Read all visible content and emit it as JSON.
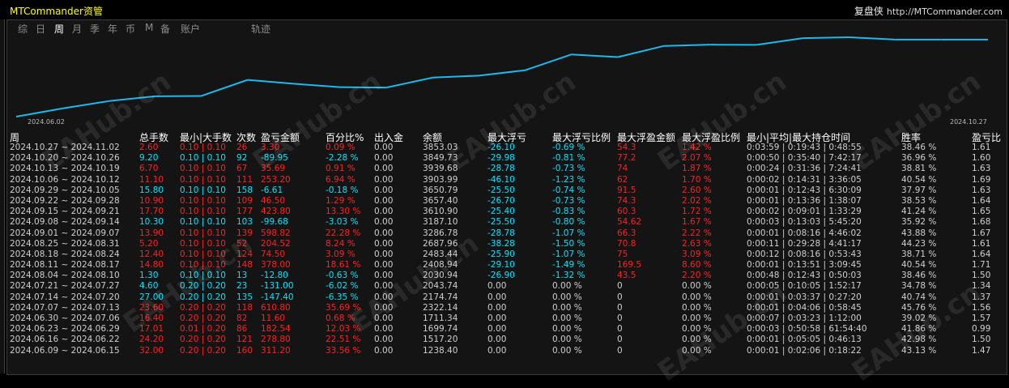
{
  "window": {
    "title": "MTCommander资管",
    "brand_cn": "复盘侠",
    "brand_url": "http://MTCommander.com"
  },
  "tabs": [
    "综",
    "日",
    "周",
    "月",
    "季",
    "年",
    "币",
    "M",
    "备",
    "账户",
    "轨迹"
  ],
  "active_tab": "周",
  "chart_data": {
    "type": "line",
    "x_start_label": "2024.06.02",
    "x_end_label": "2024.10.27",
    "x": [
      "2024.06.02",
      "2024.06.09",
      "2024.06.16",
      "2024.06.23",
      "2024.06.30",
      "2024.07.07",
      "2024.07.14",
      "2024.07.21",
      "2024.07.28",
      "2024.08.04",
      "2024.08.11",
      "2024.08.18",
      "2024.08.25",
      "2024.09.01",
      "2024.09.08",
      "2024.09.15",
      "2024.09.22",
      "2024.09.29",
      "2024.10.06",
      "2024.10.13",
      "2024.10.20",
      "2024.10.27"
    ],
    "values": [
      927.2,
      1238.4,
      1517.2,
      1699.74,
      1711.34,
      2322.14,
      2174.74,
      2043.74,
      2030.94,
      2408.94,
      2483.44,
      2687.96,
      3286.78,
      3187.1,
      3610.9,
      3657.4,
      3650.79,
      3903.99,
      3939.68,
      3849.73,
      3853.03,
      3853.03
    ],
    "line_color": "#1fb8ea"
  },
  "table": {
    "headers": {
      "period": "周",
      "lots": "总手数",
      "minmax": "最小|大手数",
      "count": "次数",
      "pl": "盈亏金额",
      "pct": "百分比%",
      "dw": "出入金",
      "balance": "余额",
      "max_float_loss": "最大浮亏",
      "max_float_loss_pct": "最大浮亏比例",
      "max_float_gain": "最大浮盈金额",
      "max_float_gain_pct": "最大浮盈比例",
      "hold": "最小|平均|最大持仓时间",
      "winrate": "胜率",
      "ratio": "盈亏比"
    },
    "rows": [
      {
        "period": "2024.10.27 ~ 2024.11.02",
        "lots": "2.60",
        "minmax": "0.10 | 0.10",
        "count": "26",
        "pl": "3.30",
        "pct": "0.09 %",
        "dw": "0.00",
        "balance": "3853.03",
        "mfl": "-26.10",
        "mflp": "-0.69 %",
        "mfg": "54.3",
        "mfgp": "1.42 %",
        "hold": "0:03:59 | 0:19:43 | 0:48:55",
        "win": "38.46 %",
        "ratio": "1.61",
        "sign": "pos"
      },
      {
        "period": "2024.10.20 ~ 2024.10.26",
        "lots": "9.20",
        "minmax": "0.10 | 0.10",
        "count": "92",
        "pl": "-89.95",
        "pct": "-2.28 %",
        "dw": "0.00",
        "balance": "3849.73",
        "mfl": "-29.98",
        "mflp": "-0.81 %",
        "mfg": "77.2",
        "mfgp": "2.07 %",
        "hold": "0:00:50 | 0:35:40 | 7:42:17",
        "win": "36.96 %",
        "ratio": "1.60",
        "sign": "neg"
      },
      {
        "period": "2024.10.13 ~ 2024.10.19",
        "lots": "6.70",
        "minmax": "0.10 | 0.10",
        "count": "67",
        "pl": "35.69",
        "pct": "0.91 %",
        "dw": "0.00",
        "balance": "3939.68",
        "mfl": "-28.78",
        "mflp": "-0.73 %",
        "mfg": "74",
        "mfgp": "1.87 %",
        "hold": "0:00:24 | 0:31:36 | 7:24:41",
        "win": "38.81 %",
        "ratio": "1.63",
        "sign": "pos"
      },
      {
        "period": "2024.10.06 ~ 2024.10.12",
        "lots": "11.10",
        "minmax": "0.10 | 0.10",
        "count": "111",
        "pl": "253.20",
        "pct": "6.94 %",
        "dw": "0.00",
        "balance": "3903.99",
        "mfl": "-46.10",
        "mflp": "-1.23 %",
        "mfg": "62",
        "mfgp": "1.70 %",
        "hold": "0:00:02 | 0:14:31 | 3:36:05",
        "win": "40.54 %",
        "ratio": "1.69",
        "sign": "pos"
      },
      {
        "period": "2024.09.29 ~ 2024.10.05",
        "lots": "15.80",
        "minmax": "0.10 | 0.10",
        "count": "158",
        "pl": "-6.61",
        "pct": "-0.18 %",
        "dw": "0.00",
        "balance": "3650.79",
        "mfl": "-25.50",
        "mflp": "-0.74 %",
        "mfg": "91.5",
        "mfgp": "2.60 %",
        "hold": "0:00:01 | 0:12:43 | 6:30:09",
        "win": "37.97 %",
        "ratio": "1.63",
        "sign": "neg"
      },
      {
        "period": "2024.09.22 ~ 2024.09.28",
        "lots": "10.90",
        "minmax": "0.10 | 0.10",
        "count": "109",
        "pl": "46.50",
        "pct": "1.29 %",
        "dw": "0.00",
        "balance": "3657.40",
        "mfl": "-26.70",
        "mflp": "-0.73 %",
        "mfg": "74.3",
        "mfgp": "2.02 %",
        "hold": "0:00:01 | 0:13:36 | 1:38:07",
        "win": "38.53 %",
        "ratio": "1.64",
        "sign": "pos"
      },
      {
        "period": "2024.09.15 ~ 2024.09.21",
        "lots": "17.70",
        "minmax": "0.10 | 0.10",
        "count": "177",
        "pl": "423.80",
        "pct": "13.30 %",
        "dw": "0.00",
        "balance": "3610.90",
        "mfl": "-25.40",
        "mflp": "-0.83 %",
        "mfg": "60.3",
        "mfgp": "1.72 %",
        "hold": "0:00:02 | 0:09:01 | 1:33:29",
        "win": "41.24 %",
        "ratio": "1.65",
        "sign": "pos"
      },
      {
        "period": "2024.09.08 ~ 2024.09.14",
        "lots": "10.30",
        "minmax": "0.10 | 0.10",
        "count": "103",
        "pl": "-99.68",
        "pct": "-3.03 %",
        "dw": "0.00",
        "balance": "3187.10",
        "mfl": "-25.50",
        "mflp": "-0.80 %",
        "mfg": "54.62",
        "mfgp": "1.67 %",
        "hold": "0:00:03 | 0:13:03 | 5:45:20",
        "win": "35.92 %",
        "ratio": "1.68",
        "sign": "neg"
      },
      {
        "period": "2024.09.01 ~ 2024.09.07",
        "lots": "13.90",
        "minmax": "0.10 | 0.10",
        "count": "139",
        "pl": "598.82",
        "pct": "22.28 %",
        "dw": "0.00",
        "balance": "3286.78",
        "mfl": "-28.78",
        "mflp": "-1.07 %",
        "mfg": "66.3",
        "mfgp": "2.22 %",
        "hold": "0:00:01 | 0:08:16 | 4:46:02",
        "win": "43.88 %",
        "ratio": "1.67",
        "sign": "pos"
      },
      {
        "period": "2024.08.25 ~ 2024.08.31",
        "lots": "5.20",
        "minmax": "0.10 | 0.10",
        "count": "52",
        "pl": "204.52",
        "pct": "8.24 %",
        "dw": "0.00",
        "balance": "2687.96",
        "mfl": "-38.28",
        "mflp": "-1.50 %",
        "mfg": "70.8",
        "mfgp": "2.63 %",
        "hold": "0:00:11 | 0:29:28 | 4:41:17",
        "win": "44.23 %",
        "ratio": "1.61",
        "sign": "pos"
      },
      {
        "period": "2024.08.18 ~ 2024.08.24",
        "lots": "12.40",
        "minmax": "0.10 | 0.10",
        "count": "124",
        "pl": "74.50",
        "pct": "3.09 %",
        "dw": "0.00",
        "balance": "2483.44",
        "mfl": "-25.90",
        "mflp": "-1.07 %",
        "mfg": "75",
        "mfgp": "3.09 %",
        "hold": "0:00:12 | 0:08:16 | 0:53:43",
        "win": "38.71 %",
        "ratio": "1.64",
        "sign": "pos"
      },
      {
        "period": "2024.08.11 ~ 2024.08.17",
        "lots": "14.80",
        "minmax": "0.10 | 0.10",
        "count": "148",
        "pl": "378.00",
        "pct": "18.61 %",
        "dw": "0.00",
        "balance": "2408.94",
        "mfl": "-29.10",
        "mflp": "-1.49 %",
        "mfg": "169.5",
        "mfgp": "8.60 %",
        "hold": "0:00:01 | 0:13:51 | 3:09:45",
        "win": "40.54 %",
        "ratio": "1.71",
        "sign": "pos"
      },
      {
        "period": "2024.08.04 ~ 2024.08.10",
        "lots": "1.30",
        "minmax": "0.10 | 0.10",
        "count": "13",
        "pl": "-12.80",
        "pct": "-0.63 %",
        "dw": "0.00",
        "balance": "2030.94",
        "mfl": "-26.90",
        "mflp": "-1.32 %",
        "mfg": "43.5",
        "mfgp": "2.20 %",
        "hold": "0:00:48 | 0:12:43 | 0:50:03",
        "win": "38.46 %",
        "ratio": "1.50",
        "sign": "neg"
      },
      {
        "period": "2024.07.21 ~ 2024.07.27",
        "lots": "4.60",
        "minmax": "0.20 | 0.20",
        "count": "23",
        "pl": "-131.00",
        "pct": "-6.02 %",
        "dw": "0.00",
        "balance": "2043.74",
        "mfl": "0.00",
        "mflp": "0.00 %",
        "mfg": "0",
        "mfgp": "0.00 %",
        "hold": "0:00:05 | 0:10:05 | 1:52:17",
        "win": "34.78 %",
        "ratio": "1.34",
        "sign": "neg"
      },
      {
        "period": "2024.07.14 ~ 2024.07.20",
        "lots": "27.00",
        "minmax": "0.20 | 0.20",
        "count": "135",
        "pl": "-147.40",
        "pct": "-6.35 %",
        "dw": "0.00",
        "balance": "2174.74",
        "mfl": "0.00",
        "mflp": "0.00 %",
        "mfg": "0",
        "mfgp": "0.00 %",
        "hold": "0:00:01 | 0:03:37 | 0:27:20",
        "win": "40.74 %",
        "ratio": "1.37",
        "sign": "neg"
      },
      {
        "period": "2024.07.07 ~ 2024.07.13",
        "lots": "23.60",
        "minmax": "0.20 | 0.20",
        "count": "118",
        "pl": "610.80",
        "pct": "35.69 %",
        "dw": "0.00",
        "balance": "2322.14",
        "mfl": "0.00",
        "mflp": "0.00 %",
        "mfg": "0",
        "mfgp": "0.00 %",
        "hold": "0:00:01 | 0:04:06 | 0:58:45",
        "win": "45.76 %",
        "ratio": "1.56",
        "sign": "pos"
      },
      {
        "period": "2024.06.30 ~ 2024.07.06",
        "lots": "16.40",
        "minmax": "0.20 | 0.20",
        "count": "82",
        "pl": "11.60",
        "pct": "0.68 %",
        "dw": "0.00",
        "balance": "1711.34",
        "mfl": "0.00",
        "mflp": "0.00 %",
        "mfg": "0",
        "mfgp": "0.00 %",
        "hold": "0:00:07 | 0:03:23 | 1:12:00",
        "win": "39.02 %",
        "ratio": "1.57",
        "sign": "pos"
      },
      {
        "period": "2024.06.23 ~ 2024.06.29",
        "lots": "17.01",
        "minmax": "0.01 | 0.20",
        "count": "86",
        "pl": "182.54",
        "pct": "12.03 %",
        "dw": "0.00",
        "balance": "1699.74",
        "mfl": "0.00",
        "mflp": "0.00 %",
        "mfg": "0",
        "mfgp": "0.00 %",
        "hold": "0:00:03 | 0:50:58 | 61:54:40",
        "win": "41.86 %",
        "ratio": "0.99",
        "sign": "pos"
      },
      {
        "period": "2024.06.16 ~ 2024.06.22",
        "lots": "24.20",
        "minmax": "0.20 | 0.20",
        "count": "121",
        "pl": "278.80",
        "pct": "22.51 %",
        "dw": "0.00",
        "balance": "1517.20",
        "mfl": "0.00",
        "mflp": "0.00 %",
        "mfg": "0",
        "mfgp": "0.00 %",
        "hold": "0:00:01 | 0:05:05 | 0:46:13",
        "win": "42.98 %",
        "ratio": "1.50",
        "sign": "pos"
      },
      {
        "period": "2024.06.09 ~ 2024.06.15",
        "lots": "32.00",
        "minmax": "0.20 | 0.20",
        "count": "160",
        "pl": "311.20",
        "pct": "33.56 %",
        "dw": "0.00",
        "balance": "1238.40",
        "mfl": "0.00",
        "mflp": "0.00 %",
        "mfg": "0",
        "mfgp": "0.00 %",
        "hold": "0:00:01 | 0:02:06 | 0:18:22",
        "win": "43.13 %",
        "ratio": "1.47",
        "sign": "pos"
      }
    ]
  },
  "watermark_text": "EAHub.cn",
  "colors": {
    "positive": "#ff2020",
    "negative": "#00e5ff",
    "title": "#ffff00",
    "line": "#1fb8ea"
  }
}
